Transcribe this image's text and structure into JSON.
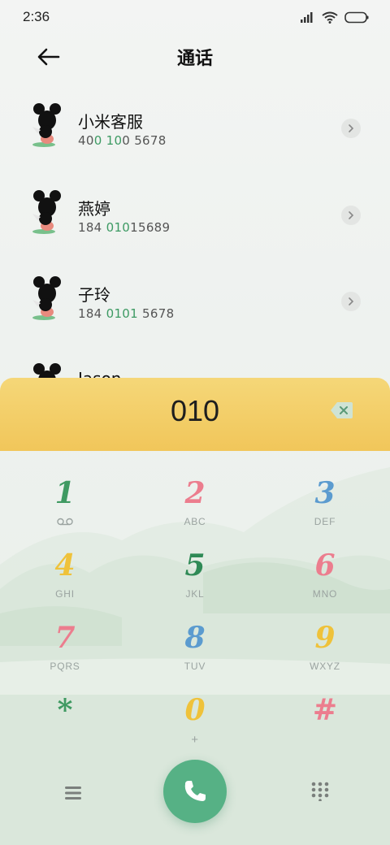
{
  "status_bar": {
    "time": "2:36"
  },
  "header": {
    "title": "通话"
  },
  "contacts": [
    {
      "name": "小米客服",
      "number_parts": [
        "40",
        "0 10",
        "0 5678"
      ]
    },
    {
      "name": "燕婷",
      "number_parts": [
        "184 ",
        "010",
        "15689"
      ]
    },
    {
      "name": "子玲",
      "number_parts": [
        "184 ",
        "0101",
        " 5678"
      ]
    },
    {
      "name": "Jason"
    }
  ],
  "dialer": {
    "number": "010"
  },
  "keys": [
    {
      "digit": "1",
      "color": "#3f9a62"
    },
    {
      "digit": "2",
      "letters": "ABC",
      "color": "#ec7d8e"
    },
    {
      "digit": "3",
      "letters": "DEF",
      "color": "#5b9bcf"
    },
    {
      "digit": "4",
      "letters": "GHI",
      "color": "#efc23a"
    },
    {
      "digit": "5",
      "letters": "JKL",
      "color": "#2f8a56"
    },
    {
      "digit": "6",
      "letters": "MNO",
      "color": "#ec7d8e"
    },
    {
      "digit": "7",
      "letters": "PQRS",
      "color": "#ec7d8e"
    },
    {
      "digit": "8",
      "letters": "TUV",
      "color": "#5b9bcf"
    },
    {
      "digit": "9",
      "letters": "WXYZ",
      "color": "#efc23a"
    },
    {
      "digit": "*",
      "color": "#3f9a62"
    },
    {
      "digit": "0",
      "letters": "+",
      "color": "#efc23a"
    },
    {
      "digit": "#",
      "color": "#ec7d8e"
    }
  ],
  "colors": {
    "accent_green": "#56b185",
    "highlight_green": "#3d9a63",
    "panel_yellow": "#f3cd66"
  },
  "icons": {
    "back": "arrow-left-icon",
    "delete": "backspace-icon",
    "call": "phone-icon",
    "menu": "menu-icon",
    "dialpad": "dialpad-icon",
    "voicemail": "voicemail-icon"
  }
}
